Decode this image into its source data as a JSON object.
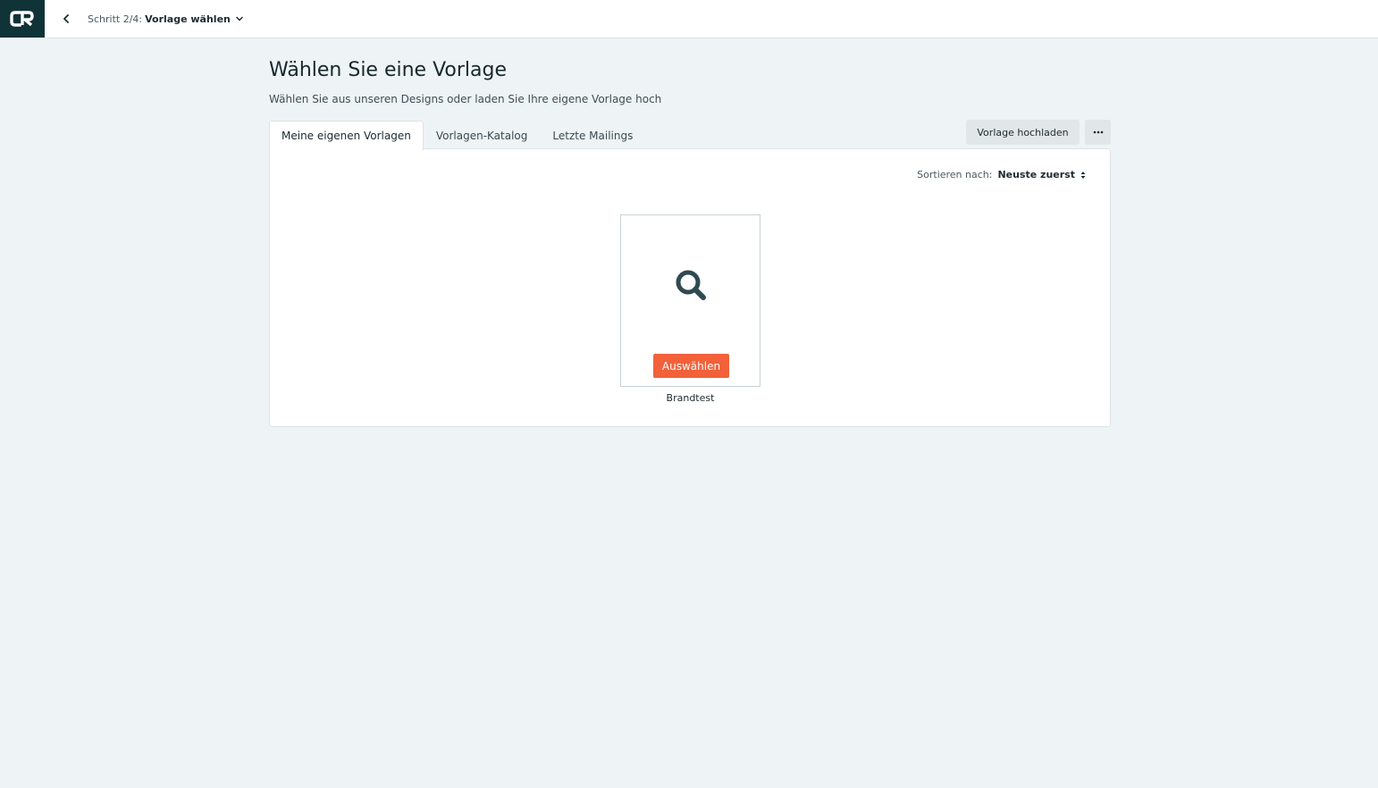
{
  "topbar": {
    "step_prefix": "Schritt 2/4:",
    "step_current": "Vorlage wählen",
    "icons": {
      "logo": "cr-logo",
      "back": "chevron-left-icon",
      "step_menu": "chevron-down-icon"
    }
  },
  "header": {
    "title": "Wählen Sie eine Vorlage",
    "subtitle": "Wählen Sie aus unseren Designs oder laden Sie Ihre eigene Vorlage hoch"
  },
  "tabs": [
    {
      "label": "Meine eigenen Vorlagen",
      "active": true
    },
    {
      "label": "Vorlagen-Katalog",
      "active": false
    },
    {
      "label": "Letzte Mailings",
      "active": false
    }
  ],
  "actions": {
    "upload_label": "Vorlage hochladen",
    "more_icon": "ellipsis-icon"
  },
  "sort": {
    "label": "Sortieren nach:",
    "value": "Neuste zuerst"
  },
  "templates": [
    {
      "name": "Brandtest",
      "select_label": "Auswählen",
      "preview_icon": "search-icon"
    }
  ],
  "colors": {
    "logo_bg": "#103338",
    "page_bg": "#eef3f5",
    "accent": "#f2613a",
    "button_grey": "#e1e6e9",
    "icon_dark": "#2f4a50"
  }
}
